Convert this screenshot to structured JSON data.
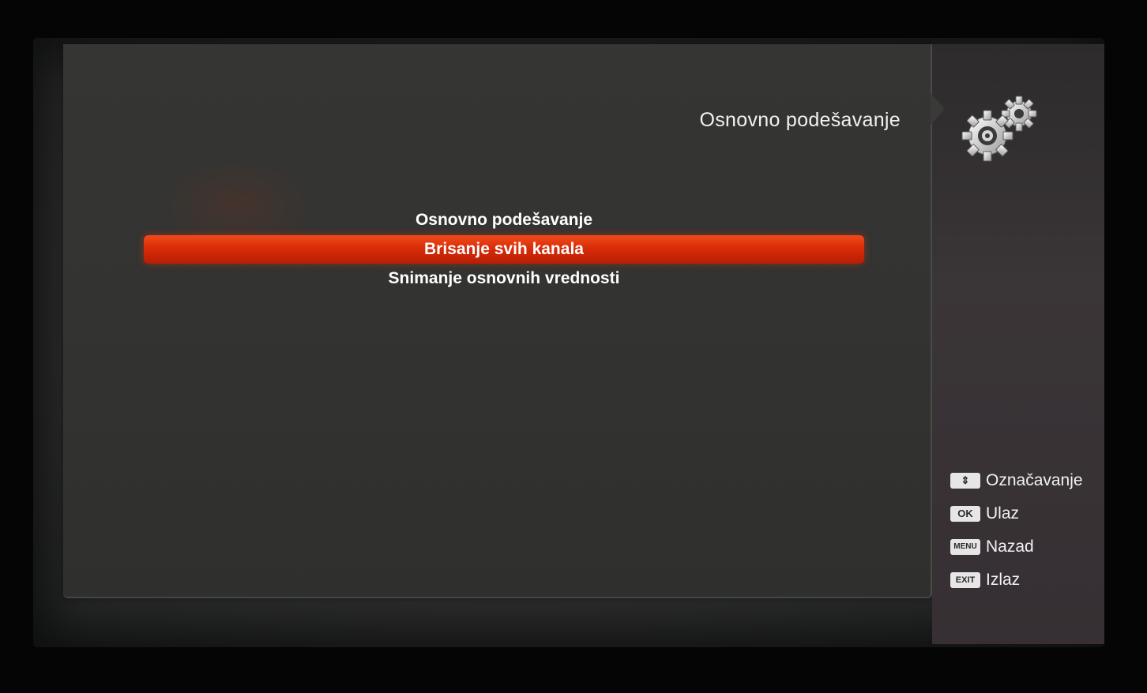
{
  "header": {
    "title": "Osnovno podešavanje",
    "icon": "gear-icon"
  },
  "menu": {
    "items": [
      {
        "label": "Osnovno podešavanje",
        "selected": false
      },
      {
        "label": "Brisanje svih kanala",
        "selected": true
      },
      {
        "label": "Snimanje osnovnih vrednosti",
        "selected": false
      }
    ],
    "highlight_color": "#d62a08"
  },
  "help": {
    "items": [
      {
        "key": "⇕",
        "label": "Označavanje",
        "icon": "up-down-arrows-icon"
      },
      {
        "key": "OK",
        "label": "Ulaz"
      },
      {
        "key": "MENU",
        "label": "Nazad"
      },
      {
        "key": "EXIT",
        "label": "Izlaz"
      }
    ]
  }
}
